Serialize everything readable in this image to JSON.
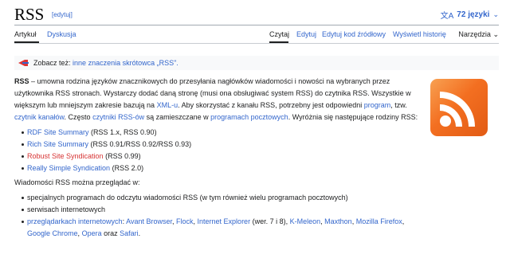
{
  "page": {
    "title": "RSS",
    "title_edit": "[edytuj]",
    "languages": "72 języki"
  },
  "tabs": {
    "left": [
      {
        "label": "Artykuł"
      },
      {
        "label": "Dyskusja"
      }
    ],
    "right": [
      {
        "label": "Czytaj"
      },
      {
        "label": "Edytuj"
      },
      {
        "label": "Edytuj kod źródłowy"
      },
      {
        "label": "Wyświetl historię"
      }
    ],
    "tools": "Narzędzia"
  },
  "hatnote": {
    "prefix": "Zobacz też:",
    "link": "inne znaczenia skrótowca „RSS\"."
  },
  "intro": {
    "term": "RSS",
    "t1": "– umowna rodzina języków znacznikowych do przesyłania nagłówków wiadomości i nowości na wybranych przez użytkownika RSS stronach. Wystarczy dodać daną stronę (musi ona obsługiwać system RSS) do czytnika RSS. Wszystkie w większym lub mniejszym zakresie bazują na",
    "xml": "XML-u",
    "t2": ". Aby skorzystać z kanału RSS, potrzebny jest odpowiedni",
    "program": "program",
    "t3": ", tzw.",
    "czytnik": "czytnik kanałów",
    "t4": ". Często",
    "czytniki": "czytniki RSS-ów",
    "t5": "są zamieszczane w",
    "programy": "programach pocztowych",
    "t6": ". Wyróżnia się następujące rodziny RSS:"
  },
  "families": [
    {
      "link": "RDF Site Summary",
      "rest": "(RSS 1.x, RSS 0.90)",
      "red": false
    },
    {
      "link": "Rich Site Summary",
      "rest": "(RSS 0.91/RSS 0.92/RSS 0.93)",
      "red": false
    },
    {
      "link": "Robust Site Syndication",
      "rest": "(RSS 0.99)",
      "red": true
    },
    {
      "link": "Really Simple Syndication",
      "rest": "(RSS 2.0)",
      "red": false
    }
  ],
  "viewing": {
    "intro": "Wiadomości RSS można przeglądać w:",
    "item1": "specjalnych programach do odczytu wiadomości RSS (w tym również wielu programach pocztowych)",
    "item2": "serwisach internetowych",
    "browsers_link": "przeglądarkach internetowych",
    "colon": ":",
    "avant": "Avant Browser",
    "flock": "Flock",
    "ie": "Internet Explorer",
    "ie_note": "(wer. 7 i 8),",
    "kmeleon": "K-Meleon",
    "maxthon": "Maxthon",
    "firefox": "Mozilla Firefox",
    "chrome": "Google Chrome",
    "opera": "Opera",
    "oraz": "oraz",
    "safari": "Safari",
    "period": "."
  },
  "icons": {
    "language": "translate-icon",
    "hatnote": "disambiguation-icon",
    "logo": "rss-feed-logo"
  },
  "colors": {
    "link": "#3366cc",
    "redlink": "#d73333",
    "rss_orange": "#f36f21"
  }
}
